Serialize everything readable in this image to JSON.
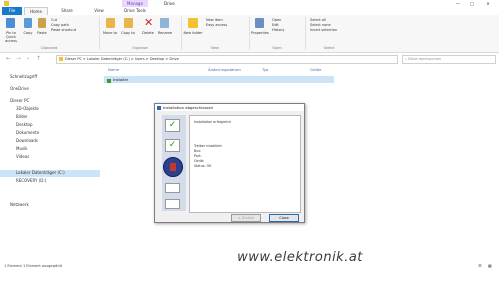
{
  "window": {
    "title": "Drive",
    "tool_tab": "Manage",
    "minimize": "—",
    "maximize": "□",
    "close": "✕"
  },
  "ribbon": {
    "tabs": [
      "File",
      "Home",
      "Share",
      "View",
      "Drive Tools"
    ],
    "buttons": [
      {
        "label": "Pin to Quick access",
        "icon": "pin-icon"
      },
      {
        "label": "Copy",
        "icon": "copy-icon"
      },
      {
        "label": "Paste",
        "icon": "paste-icon"
      },
      {
        "label": "Move to",
        "icon": "move-icon"
      },
      {
        "label": "Copy to",
        "icon": "copy-to-icon"
      },
      {
        "label": "Delete",
        "icon": "delete-icon"
      },
      {
        "label": "Rename",
        "icon": "rename-icon"
      },
      {
        "label": "New folder",
        "icon": "new-folder-icon"
      },
      {
        "label": "Properties",
        "icon": "properties-icon"
      },
      {
        "label": "Select all",
        "icon": "select-all-icon"
      }
    ],
    "groups": [
      "Clipboard",
      "Organize",
      "New",
      "Open",
      "Select"
    ],
    "small_items": [
      "Cut",
      "Copy path",
      "Paste shortcut",
      "New item",
      "Easy access",
      "Open",
      "Edit",
      "History",
      "Select none",
      "Invert selection"
    ]
  },
  "address": {
    "path": "Dieser PC > Lokaler Datenträger (C:) > Users > Desktop > Drive",
    "search_placeholder": "Drive durchsuchen"
  },
  "nav": {
    "items": [
      "Schnellzugriff",
      "OneDrive",
      "Dieser PC",
      "3D-Objekte",
      "Bilder",
      "Desktop",
      "Dokumente",
      "Downloads",
      "Musik",
      "Videos",
      "Lokaler Datenträger (C:)",
      "RECOVERY (D:)",
      "Netzwerk"
    ]
  },
  "columns": [
    "Name",
    "Änderungsdatum",
    "Typ",
    "Größe"
  ],
  "files": [
    {
      "name": "Installer",
      "date": "",
      "type": "",
      "size": ""
    }
  ],
  "status": {
    "text": "1 Element   1 Element ausgewählt"
  },
  "dialog": {
    "title": "Installation abgeschlossen",
    "lines": [
      "Installation erfolgreich",
      "",
      "Treiber installiert",
      "Bus:",
      "Port:",
      "Gerät:",
      "Status: OK",
      "",
      "",
      "",
      "",
      ""
    ],
    "button_back": "< Zurück",
    "button_close": "Close"
  },
  "watermark": {
    "text": "www.elektronik.at"
  }
}
